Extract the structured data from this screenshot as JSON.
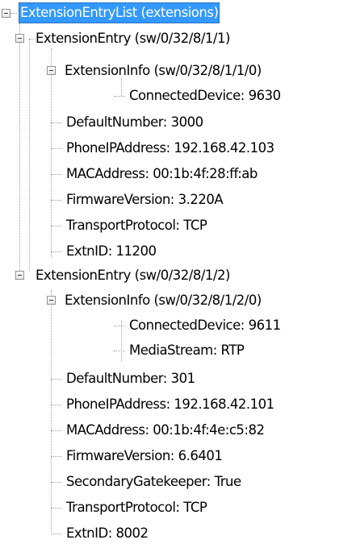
{
  "tree": {
    "root": {
      "label": "ExtensionEntryList (extensions)"
    },
    "entry1": {
      "label": "ExtensionEntry (sw/0/32/8/1/1)",
      "info": {
        "label": "ExtensionInfo (sw/0/32/8/1/1/0)",
        "connected_device": "ConnectedDevice: 9630"
      },
      "default_number": "DefaultNumber: 3000",
      "phone_ip": "PhoneIPAddress: 192.168.42.103",
      "mac": "MACAddress: 00:1b:4f:28:ff:ab",
      "firmware": "FirmwareVersion: 3.220A",
      "transport": "TransportProtocol: TCP",
      "extn_id": "ExtnID: 11200"
    },
    "entry2": {
      "label": "ExtensionEntry (sw/0/32/8/1/2)",
      "info": {
        "label": "ExtensionInfo (sw/0/32/8/1/2/0)",
        "connected_device": "ConnectedDevice: 9611",
        "media_stream": "MediaStream: RTP"
      },
      "default_number": "DefaultNumber: 301",
      "phone_ip": "PhoneIPAddress: 192.168.42.101",
      "mac": "MACAddress: 00:1b:4f:4e:c5:82",
      "firmware": "FirmwareVersion: 6.6401",
      "secondary_gatekeeper": "SecondaryGatekeeper: True",
      "transport": "TransportProtocol: TCP",
      "extn_id": "ExtnID: 8002"
    }
  },
  "colors": {
    "selection": "#3399ff",
    "tree_lines": "#a0a0a0"
  }
}
